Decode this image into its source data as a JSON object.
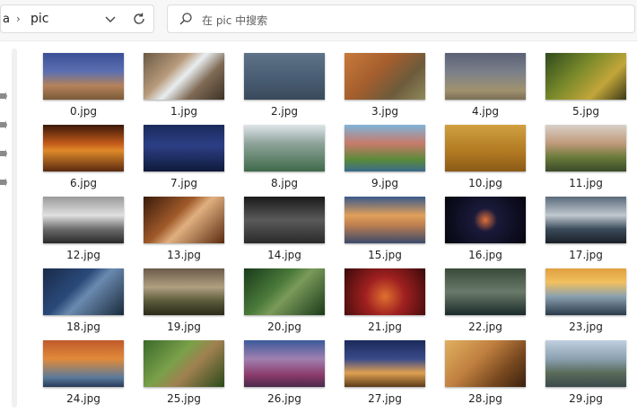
{
  "address": {
    "crumb_parent": "a",
    "separator": "›",
    "current": "pic"
  },
  "search": {
    "placeholder": "在 pic 中搜索"
  },
  "icons": {
    "dropdown": "chevron-down-icon",
    "refresh": "refresh-icon",
    "search": "search-icon",
    "pin": "pin-icon"
  },
  "files": [
    {
      "name": "0.jpg",
      "bg": "linear-gradient(180deg,#3b4f96 0%,#5b6fb0 40%,#b5825a 70%,#7a5a3a 100%)"
    },
    {
      "name": "1.jpg",
      "bg": "linear-gradient(135deg,#6b5a45 0%,#b79a7a 35%,#e8eef0 50%,#7f6a55 70%,#3e3226 100%)"
    },
    {
      "name": "2.jpg",
      "bg": "linear-gradient(180deg,#5f7388 0%,#4a5f75 50%,#3a4a5c 100%)"
    },
    {
      "name": "3.jpg",
      "bg": "linear-gradient(135deg,#c77a3a 0%,#a55e2d 40%,#6d5b3c 70%,#8e8a5a 100%)"
    },
    {
      "name": "4.jpg",
      "bg": "linear-gradient(180deg,#5a6175 0%,#7a7f8a 40%,#a0926e 80%,#7a6e55 100%)"
    },
    {
      "name": "5.jpg",
      "bg": "linear-gradient(135deg,#2f4a1e 0%,#7a8a2a 40%,#c2a53a 70%,#3c3a18 100%)"
    },
    {
      "name": "6.jpg",
      "bg": "linear-gradient(180deg,#3a1808 0%,#c25a1a 40%,#e08a2a 55%,#5a2a10 100%)"
    },
    {
      "name": "7.jpg",
      "bg": "linear-gradient(180deg,#1a2a5c 0%,#2c3f85 45%,#0f1a3a 100%)"
    },
    {
      "name": "8.jpg",
      "bg": "linear-gradient(180deg,#dfe5ea 0%,#8ea39a 40%,#3f6a4a 100%)"
    },
    {
      "name": "9.jpg",
      "bg": "linear-gradient(180deg,#7fb3d8 0%,#c87a6a 40%,#5a8a3a 75%,#3a6a8a 100%)"
    },
    {
      "name": "10.jpg",
      "bg": "linear-gradient(180deg,#d0a040 0%,#b07820 60%,#8a5a18 100%)"
    },
    {
      "name": "11.jpg",
      "bg": "linear-gradient(180deg,#d8d0c8 0%,#c09a7a 40%,#6a7a3a 70%,#3a4a2a 100%)"
    },
    {
      "name": "12.jpg",
      "bg": "linear-gradient(180deg,#9a9a9a 0%,#e0e0e0 40%,#6a6a6a 70%,#2a2a2a 100%)"
    },
    {
      "name": "13.jpg",
      "bg": "linear-gradient(135deg,#3a1a0a 0%,#a05a2a 40%,#e0b080 55%,#5a2a10 100%)"
    },
    {
      "name": "14.jpg",
      "bg": "linear-gradient(180deg,#1a1a1a 0%,#5a5a5a 50%,#2a2a2a 100%)"
    },
    {
      "name": "15.jpg",
      "bg": "linear-gradient(180deg,#3a5a8a 0%,#e0a05a 40%,#c08050 60%,#3a4a6a 100%)"
    },
    {
      "name": "16.jpg",
      "bg": "radial-gradient(circle at 50% 50%,#e0703a 0%,#1a1a3a 25%,#05050f 100%)"
    },
    {
      "name": "17.jpg",
      "bg": "linear-gradient(180deg,#5a6a7a 0%,#c0c8d0 40%,#3a4a5a 70%,#1a2028 100%)"
    },
    {
      "name": "18.jpg",
      "bg": "linear-gradient(135deg,#1a2a4a 0%,#2a4a7a 40%,#6a8ab0 55%,#1a2a3a 100%)"
    },
    {
      "name": "19.jpg",
      "bg": "linear-gradient(180deg,#6a5a4a 0%,#b0a080 40%,#5a5a3a 70%,#2a2a1a 100%)"
    },
    {
      "name": "20.jpg",
      "bg": "linear-gradient(135deg,#1a3a1a 0%,#4a7a3a 40%,#7a9a5a 55%,#1a3a1a 100%)"
    },
    {
      "name": "21.jpg",
      "bg": "radial-gradient(circle at 50% 60%,#e07030 0%,#a02020 40%,#3a0a0a 100%)"
    },
    {
      "name": "22.jpg",
      "bg": "linear-gradient(180deg,#3a4a3a 0%,#6a7a6a 50%,#1a2a2a 100%)"
    },
    {
      "name": "23.jpg",
      "bg": "linear-gradient(180deg,#e0a040 0%,#f0c060 30%,#8aa0b0 60%,#2a3a4a 100%)"
    },
    {
      "name": "24.jpg",
      "bg": "linear-gradient(180deg,#c05a2a 0%,#e08a3a 40%,#5a7a9a 80%,#2a3a5a 100%)"
    },
    {
      "name": "25.jpg",
      "bg": "linear-gradient(135deg,#3a6a2a 0%,#7aa04a 40%,#a08050 60%,#2a4a1a 100%)"
    },
    {
      "name": "26.jpg",
      "bg": "linear-gradient(180deg,#3a5a9a 0%,#a080b0 40%,#8a3a6a 75%,#4a2a4a 100%)"
    },
    {
      "name": "27.jpg",
      "bg": "linear-gradient(180deg,#1a2a5a 0%,#3a4a8a 40%,#e0a050 70%,#5a3a1a 100%)"
    },
    {
      "name": "28.jpg",
      "bg": "linear-gradient(135deg,#e0b060 0%,#c08040 40%,#7a4a20 70%,#3a2010 100%)"
    },
    {
      "name": "29.jpg",
      "bg": "linear-gradient(180deg,#c0d0e0 0%,#8aa0b0 40%,#5a6a5a 70%,#3a4a4a 100%)"
    }
  ]
}
